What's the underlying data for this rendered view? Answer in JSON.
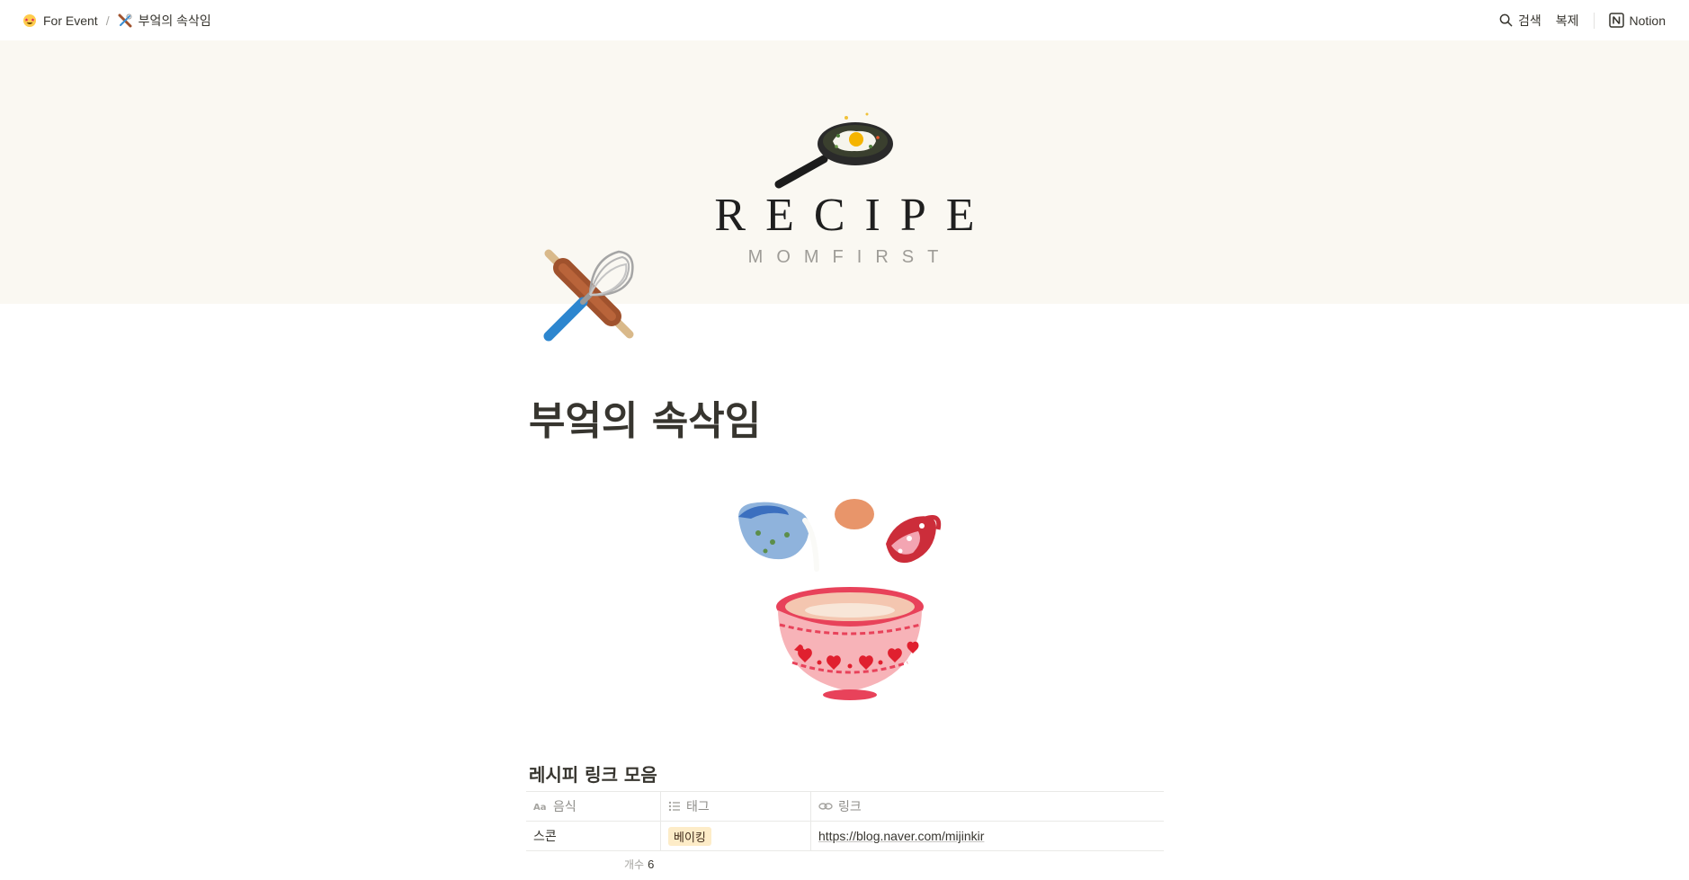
{
  "breadcrumb": {
    "items": [
      {
        "label": "For Event",
        "icon": "star-struck-emoji-icon"
      },
      {
        "label": "부엌의 속삭임",
        "icon": "rolling-pin-whisk-icon"
      }
    ],
    "separator": "/"
  },
  "topbar": {
    "search_label": "검색",
    "duplicate_label": "복제",
    "notion_label": "Notion"
  },
  "cover": {
    "title": "RECIPE",
    "subtitle": "MOMFIRST"
  },
  "page": {
    "title": "부엌의 속삭임"
  },
  "database": {
    "title": "레시피 링크 모음",
    "columns": [
      {
        "label": "음식",
        "icon": "text-aa-icon"
      },
      {
        "label": "태그",
        "icon": "list-icon"
      },
      {
        "label": "링크",
        "icon": "link-icon"
      }
    ],
    "rows": [
      {
        "food": "스콘",
        "tag": "베이킹",
        "link": "https://blog.naver.com/mijinkir"
      }
    ],
    "count_label": "개수",
    "count_value": "6"
  },
  "colors": {
    "cover_bg": "#faf8f2",
    "tag_bg": "#fdecc8",
    "text": "#37352f"
  }
}
